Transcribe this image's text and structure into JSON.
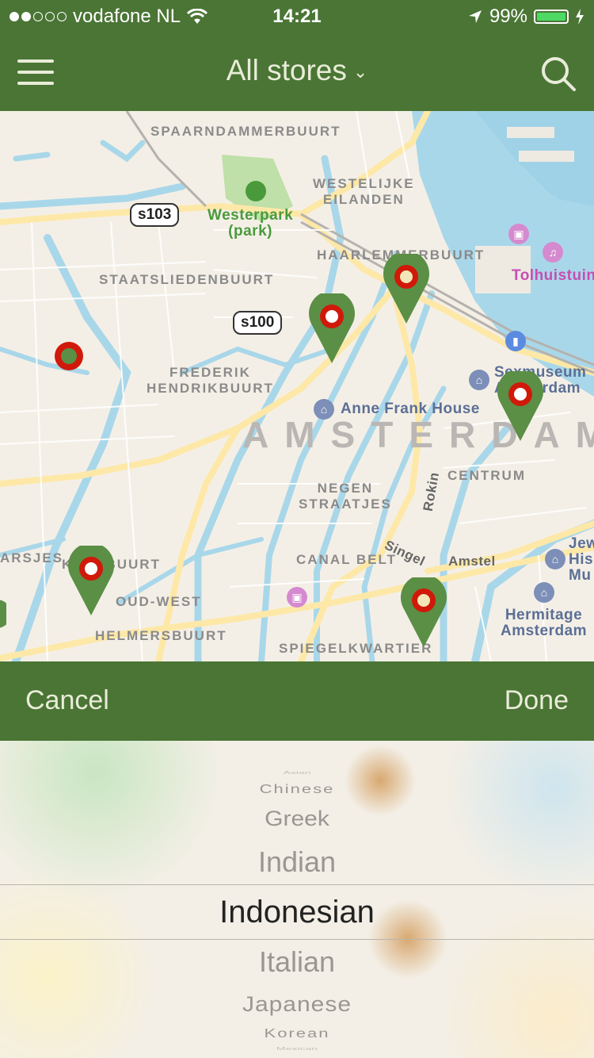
{
  "status_bar": {
    "carrier": "vodafone NL",
    "time": "14:21",
    "battery": "99%",
    "battery_level": 0.99,
    "signal_strength": 2
  },
  "nav": {
    "title": "All stores",
    "icons": [
      "menu-icon",
      "chevron-down-icon",
      "search-icon"
    ]
  },
  "map": {
    "labels": {
      "spaarndammerbuurt": "SPAARNDAMMERBUURT",
      "westelijke_eilanden": "WESTELIJKE\nEILANDEN",
      "westerpark": "Westerpark\n(park)",
      "haarlemmerbuurt": "HAARLEMMERBUURT",
      "tolhuistuin": "Tolhuistuin",
      "staatsliedenbuurt": "STAATSLIEDENBUURT",
      "frederik": "FREDERIK\nHENDRIKBUURT",
      "sexmuseum": "Sexmuseum\nAmsterdam",
      "anne_frank": "Anne Frank House",
      "amsterdam": "AMSTERDAM",
      "centrum": "CENTRUM",
      "negen_straatjes": "NEGEN\nSTRAATJES",
      "rokin": "Rokin",
      "singel": "Singel",
      "amstel": "Amstel",
      "canal_belt": "CANAL BELT",
      "arsjes": "ARSJES",
      "kinkerbuurt": "K    RBUURT",
      "oud_west": "OUD-WEST",
      "helmersbuurt": "HELMERSBUURT",
      "spiegelkwartier": "SPIEGELKWARTIER",
      "hermitage": "Hermitage\nAmsterdam",
      "jewish": "Jew\nHis\nMu"
    },
    "shields": {
      "s103": "s103",
      "s100": "s100"
    },
    "colors": {
      "pin": "#5a8f45",
      "ring": "#d0190a",
      "water": "#a9d7ea",
      "road": "#fde8a8"
    }
  },
  "toolbar": {
    "cancel": "Cancel",
    "done": "Done"
  },
  "picker": {
    "options": [
      "Asian",
      "Chinese",
      "Greek",
      "Indian",
      "Indonesian",
      "Italian",
      "Japanese",
      "Korean",
      "Mexican"
    ],
    "selected": "Indonesian"
  }
}
